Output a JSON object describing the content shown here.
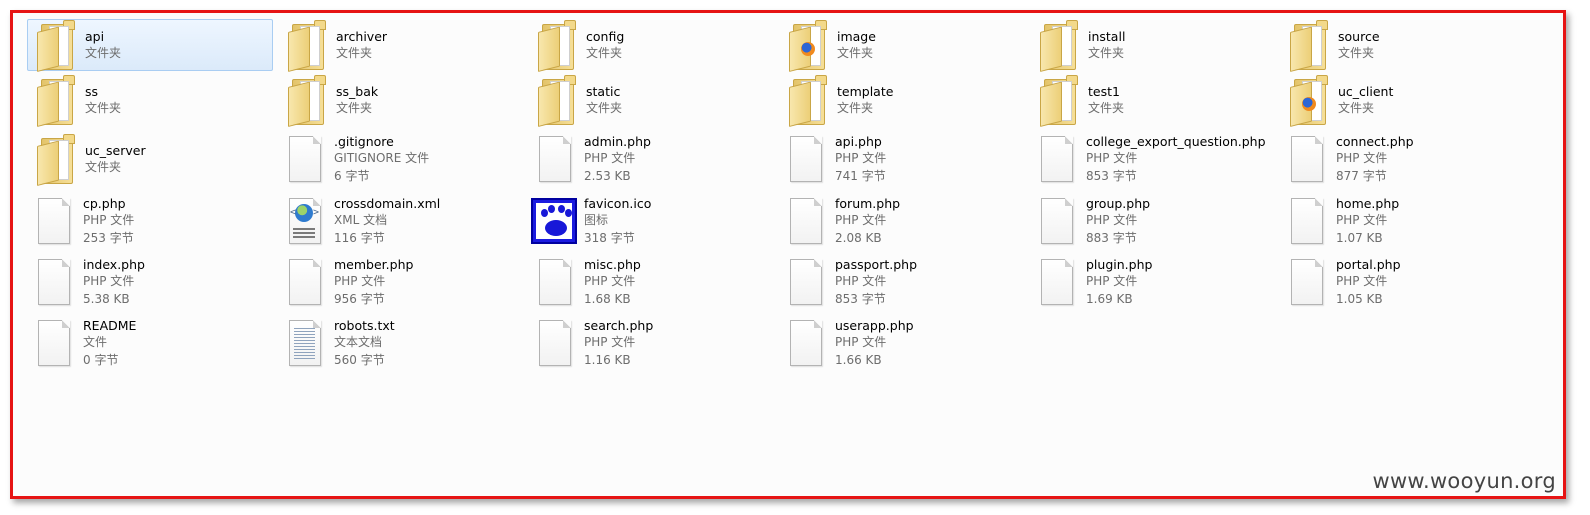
{
  "colors": {
    "frame_border": "#e61414",
    "selection_bg": "#dbeafa",
    "selection_border": "#a9cdf2"
  },
  "watermark": "www.wooyun.org",
  "items": [
    {
      "name": "api",
      "sub1": "文件夹",
      "icon": "folder-icon",
      "selected": true
    },
    {
      "name": "archiver",
      "sub1": "文件夹",
      "icon": "folder-icon"
    },
    {
      "name": "config",
      "sub1": "文件夹",
      "icon": "folder-icon"
    },
    {
      "name": "image",
      "sub1": "文件夹",
      "icon": "folder-icon",
      "badge": "firefox"
    },
    {
      "name": "install",
      "sub1": "文件夹",
      "icon": "folder-icon"
    },
    {
      "name": "source",
      "sub1": "文件夹",
      "icon": "folder-icon"
    },
    {
      "name": "ss",
      "sub1": "文件夹",
      "icon": "folder-icon"
    },
    {
      "name": "ss_bak",
      "sub1": "文件夹",
      "icon": "folder-icon"
    },
    {
      "name": "static",
      "sub1": "文件夹",
      "icon": "folder-icon"
    },
    {
      "name": "template",
      "sub1": "文件夹",
      "icon": "folder-icon"
    },
    {
      "name": "test1",
      "sub1": "文件夹",
      "icon": "folder-icon"
    },
    {
      "name": "uc_client",
      "sub1": "文件夹",
      "icon": "folder-icon",
      "badge": "firefox"
    },
    {
      "name": "uc_server",
      "sub1": "文件夹",
      "icon": "folder-icon"
    },
    {
      "name": ".gitignore",
      "sub1": "GITIGNORE 文件",
      "sub2": "6 字节",
      "icon": "document-icon"
    },
    {
      "name": "admin.php",
      "sub1": "PHP 文件",
      "sub2": "2.53 KB",
      "icon": "document-icon"
    },
    {
      "name": "api.php",
      "sub1": "PHP 文件",
      "sub2": "741 字节",
      "icon": "document-icon"
    },
    {
      "name": "college_export_question.php",
      "sub1": "PHP 文件",
      "sub2": "853 字节",
      "icon": "document-icon"
    },
    {
      "name": "connect.php",
      "sub1": "PHP 文件",
      "sub2": "877 字节",
      "icon": "document-icon"
    },
    {
      "name": "cp.php",
      "sub1": "PHP 文件",
      "sub2": "253 字节",
      "icon": "document-icon"
    },
    {
      "name": "crossdomain.xml",
      "sub1": "XML 文档",
      "sub2": "116 字节",
      "icon": "xml-document-icon"
    },
    {
      "name": "favicon.ico",
      "sub1": "图标",
      "sub2": "318 字节",
      "icon": "paw-icon"
    },
    {
      "name": "forum.php",
      "sub1": "PHP 文件",
      "sub2": "2.08 KB",
      "icon": "document-icon"
    },
    {
      "name": "group.php",
      "sub1": "PHP 文件",
      "sub2": "883 字节",
      "icon": "document-icon"
    },
    {
      "name": "home.php",
      "sub1": "PHP 文件",
      "sub2": "1.07 KB",
      "icon": "document-icon"
    },
    {
      "name": "index.php",
      "sub1": "PHP 文件",
      "sub2": "5.38 KB",
      "icon": "document-icon"
    },
    {
      "name": "member.php",
      "sub1": "PHP 文件",
      "sub2": "956 字节",
      "icon": "document-icon"
    },
    {
      "name": "misc.php",
      "sub1": "PHP 文件",
      "sub2": "1.68 KB",
      "icon": "document-icon"
    },
    {
      "name": "passport.php",
      "sub1": "PHP 文件",
      "sub2": "853 字节",
      "icon": "document-icon"
    },
    {
      "name": "plugin.php",
      "sub1": "PHP 文件",
      "sub2": "1.69 KB",
      "icon": "document-icon"
    },
    {
      "name": "portal.php",
      "sub1": "PHP 文件",
      "sub2": "1.05 KB",
      "icon": "document-icon"
    },
    {
      "name": "README",
      "sub1": "文件",
      "sub2": "0 字节",
      "icon": "document-icon"
    },
    {
      "name": "robots.txt",
      "sub1": "文本文档",
      "sub2": "560 字节",
      "icon": "text-document-icon"
    },
    {
      "name": "search.php",
      "sub1": "PHP 文件",
      "sub2": "1.16 KB",
      "icon": "document-icon"
    },
    {
      "name": "userapp.php",
      "sub1": "PHP 文件",
      "sub2": "1.66 KB",
      "icon": "document-icon"
    }
  ]
}
